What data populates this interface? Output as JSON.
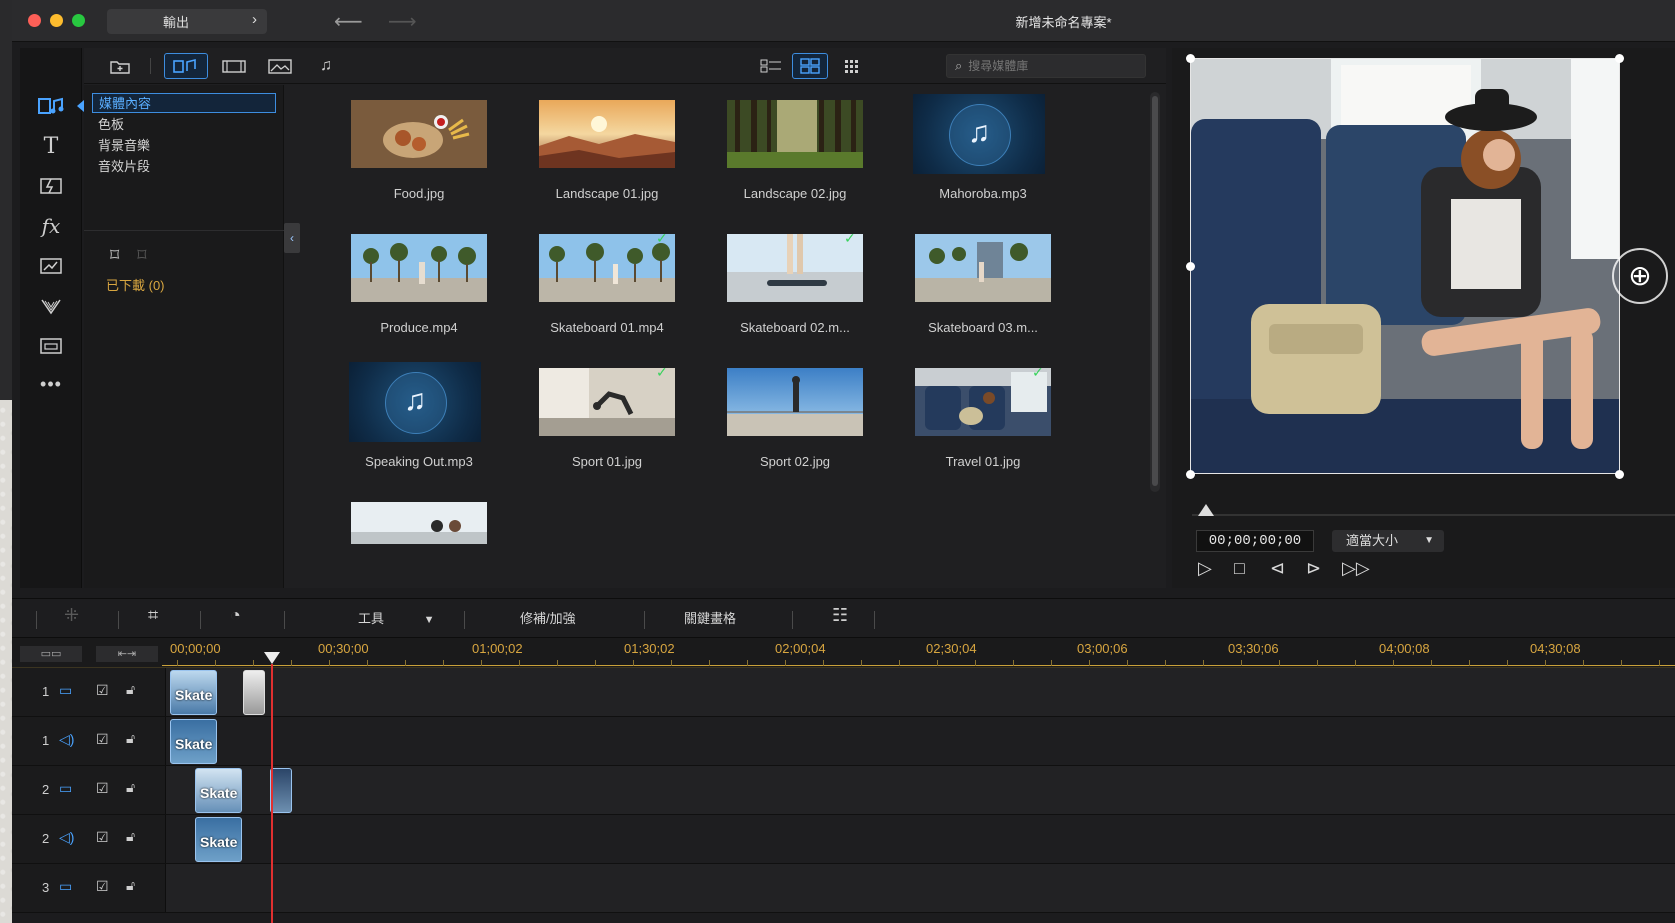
{
  "window": {
    "title": "新增未命名專案*",
    "export_label": "輸出"
  },
  "colors": {
    "accent": "#4aa3ff",
    "timeline_gold": "#d8a640",
    "playhead": "#e03030",
    "check_green": "#38d25c"
  },
  "left_tools": [
    {
      "name": "media-room",
      "icon": "media-icon"
    },
    {
      "name": "title-room",
      "icon": "text-icon"
    },
    {
      "name": "transition-room",
      "icon": "transition-icon"
    },
    {
      "name": "effect-room",
      "icon": "fx-icon"
    },
    {
      "name": "pip-room",
      "icon": "pip-icon"
    },
    {
      "name": "particle-room",
      "icon": "particle-icon"
    },
    {
      "name": "subtitle-room",
      "icon": "subtitle-icon"
    },
    {
      "name": "more",
      "icon": "more-icon"
    }
  ],
  "media": {
    "search_placeholder": "搜尋媒體庫",
    "tree": [
      "媒體內容",
      "色板",
      "背景音樂",
      "音效片段"
    ],
    "downloaded": "已下載 (0)",
    "items": [
      {
        "label": "Food.jpg",
        "kind": "image",
        "checked": false
      },
      {
        "label": "Landscape 01.jpg",
        "kind": "image",
        "checked": false
      },
      {
        "label": "Landscape 02.jpg",
        "kind": "image",
        "checked": false
      },
      {
        "label": "Mahoroba.mp3",
        "kind": "audio",
        "checked": false
      },
      {
        "label": "Produce.mp4",
        "kind": "video",
        "checked": false
      },
      {
        "label": "Skateboard 01.mp4",
        "kind": "video",
        "checked": true
      },
      {
        "label": "Skateboard 02.m...",
        "kind": "video",
        "checked": true
      },
      {
        "label": "Skateboard 03.m...",
        "kind": "video",
        "checked": false
      },
      {
        "label": "Speaking Out.mp3",
        "kind": "audio",
        "checked": false
      },
      {
        "label": "Sport 01.jpg",
        "kind": "image",
        "checked": true
      },
      {
        "label": "Sport 02.jpg",
        "kind": "image",
        "checked": false
      },
      {
        "label": "Travel 01.jpg",
        "kind": "image",
        "checked": true
      },
      {
        "label": "",
        "kind": "image",
        "checked": false
      }
    ]
  },
  "preview": {
    "timecode": "00;00;00;00",
    "fit_label": "適當大小"
  },
  "timeline": {
    "tools_label": "工具",
    "fix_label": "修補/加強",
    "keyframe_label": "關鍵畫格",
    "ticks": [
      "00;00;00",
      "00;30;00",
      "01;00;02",
      "01;30;02",
      "02;00;04",
      "02;30;04",
      "03;00;06",
      "03;30;06",
      "04;00;08",
      "04;30;08"
    ],
    "tracks": [
      {
        "num": "1",
        "type": "video"
      },
      {
        "num": "1",
        "type": "audio"
      },
      {
        "num": "2",
        "type": "video"
      },
      {
        "num": "2",
        "type": "audio"
      },
      {
        "num": "3",
        "type": "video"
      }
    ],
    "clip_label": "Skate"
  }
}
